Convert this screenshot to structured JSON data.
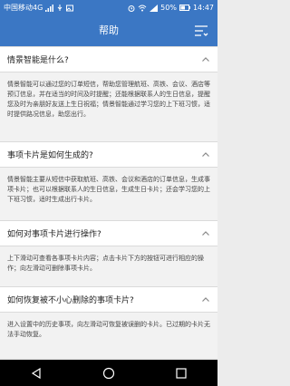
{
  "status_bar": {
    "carrier": "中国移动4G",
    "battery": "50%",
    "time": "14:47"
  },
  "header": {
    "title": "帮助"
  },
  "faq": [
    {
      "question": "情景智能是什么?",
      "answer": "情景智能可以通过您的订单短信，帮助您管理航班、高铁、会议、酒店等预订信息，并在适当的时间及时提醒；还能根据联系人的生日信息，提醒您及时为亲朋好友送上生日祝福；情景智能通过学习您的上下班习惯，适时提供路况信息，助您出行。"
    },
    {
      "question": "事项卡片是如何生成的?",
      "answer": "情景智能主要从短信中获取航班、高铁、会议和酒店的订单信息，生成事项卡片；也可以根据联系人的生日信息，生成生日卡片；还会学习您的上下班习惯，适时生成出行卡片。"
    },
    {
      "question": "如何对事项卡片进行操作?",
      "answer": "上下滑动可查看各事项卡片内容；点击卡片下方的按钮可进行相应的操作；向左滑动可删除事项卡片。"
    },
    {
      "question": "如何恢复被不小心删除的事项卡片?",
      "answer": "进入设置中的历史事项，向左滑动可恢复被误删的卡片。已过期的卡片无法手动恢复。"
    }
  ]
}
